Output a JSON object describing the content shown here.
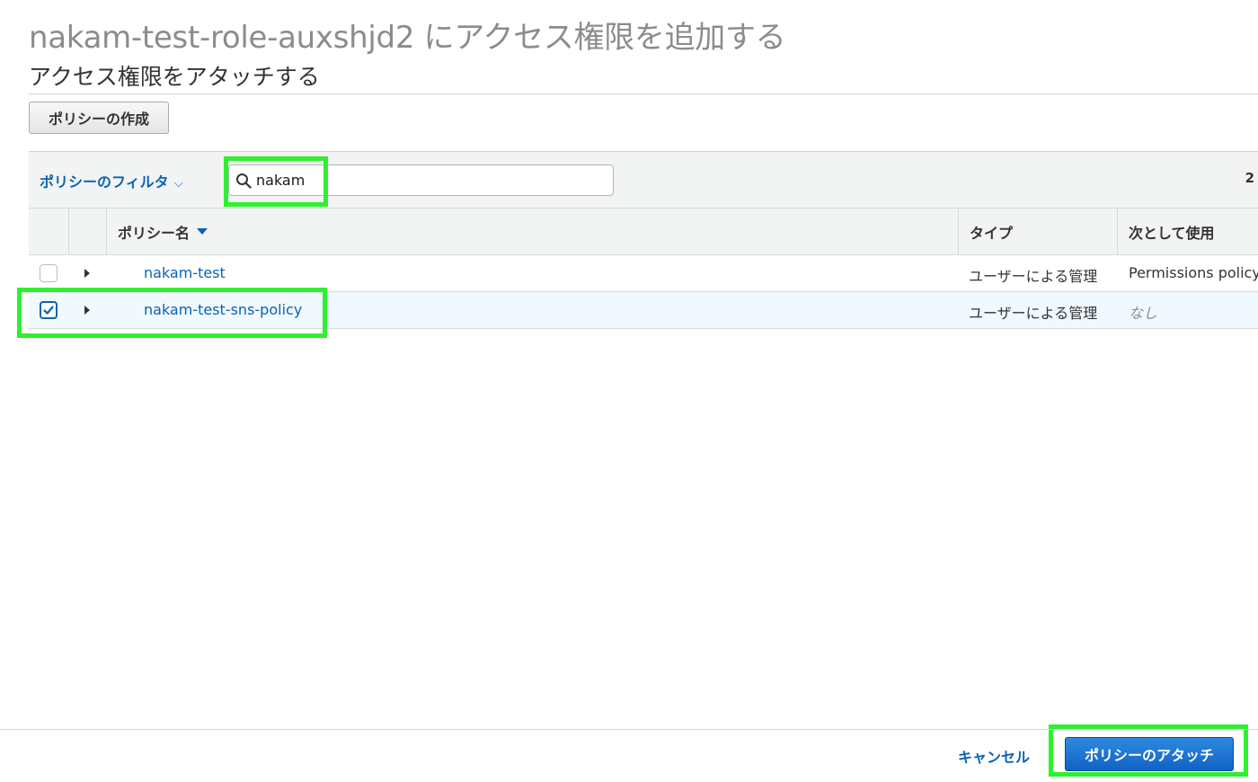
{
  "header": {
    "title": "nakam-test-role-auxshjd2 にアクセス権限を追加する",
    "section_title": "アクセス権限をアタッチする",
    "create_policy_label": "ポリシーの作成"
  },
  "filter": {
    "dropdown_label": "ポリシーのフィルタ",
    "search_value": "nakam",
    "result_count": "2"
  },
  "table": {
    "columns": {
      "name": "ポリシー名",
      "type": "タイプ",
      "usage": "次として使用"
    },
    "rows": [
      {
        "name": "nakam-test",
        "type": "ユーザーによる管理",
        "usage": "Permissions policy",
        "checked": false
      },
      {
        "name": "nakam-test-sns-policy",
        "type": "ユーザーによる管理",
        "usage": "なし",
        "checked": true
      }
    ]
  },
  "footer": {
    "cancel_label": "キャンセル",
    "attach_label": "ポリシーのアタッチ"
  },
  "colors": {
    "link": "#0a63b3",
    "highlight": "#2ef02e",
    "primary_button": "#1162c4"
  }
}
